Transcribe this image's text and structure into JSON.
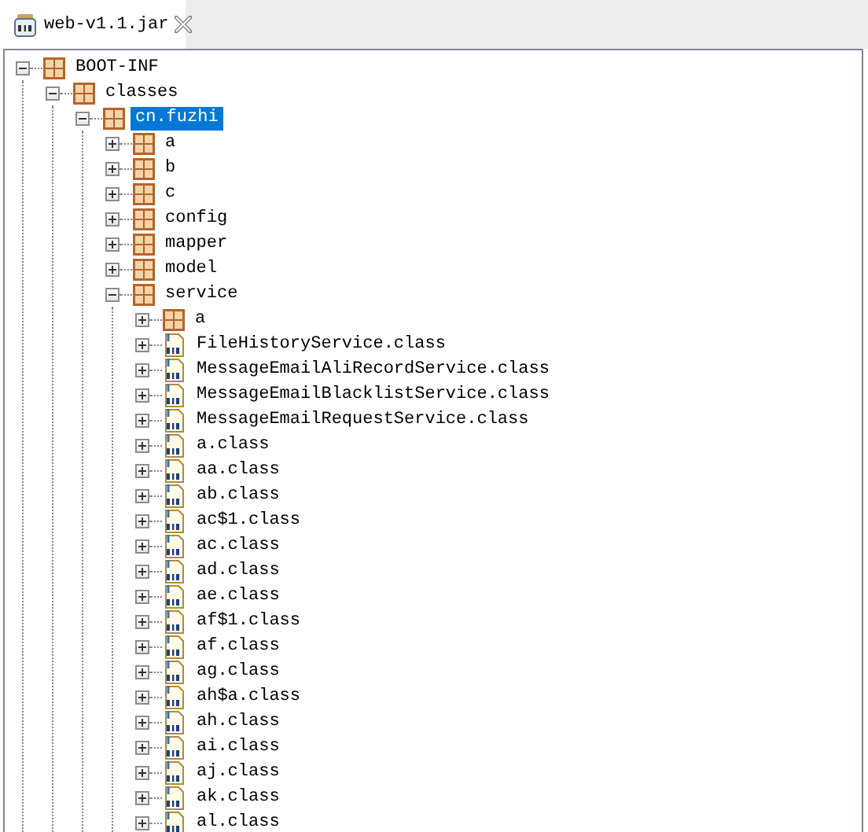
{
  "tabs": [
    {
      "label": "web-v1.1.jar",
      "selected": true
    }
  ],
  "tree": [
    {
      "label": "BOOT-INF",
      "kind": "package",
      "expanded": true,
      "selected": false,
      "children": [
        {
          "label": "classes",
          "kind": "package",
          "expanded": true,
          "selected": false,
          "children": [
            {
              "label": "cn.fuzhi",
              "kind": "package",
              "expanded": true,
              "selected": true,
              "children": [
                {
                  "label": "a",
                  "kind": "package",
                  "expanded": false,
                  "selected": false
                },
                {
                  "label": "b",
                  "kind": "package",
                  "expanded": false,
                  "selected": false
                },
                {
                  "label": "c",
                  "kind": "package",
                  "expanded": false,
                  "selected": false
                },
                {
                  "label": "config",
                  "kind": "package",
                  "expanded": false,
                  "selected": false
                },
                {
                  "label": "mapper",
                  "kind": "package",
                  "expanded": false,
                  "selected": false
                },
                {
                  "label": "model",
                  "kind": "package",
                  "expanded": false,
                  "selected": false
                },
                {
                  "label": "service",
                  "kind": "package",
                  "expanded": true,
                  "selected": false,
                  "children": [
                    {
                      "label": "a",
                      "kind": "package",
                      "expanded": false,
                      "selected": false
                    },
                    {
                      "label": "FileHistoryService.class",
                      "kind": "class",
                      "expanded": false,
                      "selected": false
                    },
                    {
                      "label": "MessageEmailAliRecordService.class",
                      "kind": "class",
                      "expanded": false,
                      "selected": false
                    },
                    {
                      "label": "MessageEmailBlacklistService.class",
                      "kind": "class",
                      "expanded": false,
                      "selected": false
                    },
                    {
                      "label": "MessageEmailRequestService.class",
                      "kind": "class",
                      "expanded": false,
                      "selected": false
                    },
                    {
                      "label": "a.class",
                      "kind": "class",
                      "expanded": false,
                      "selected": false
                    },
                    {
                      "label": "aa.class",
                      "kind": "class",
                      "expanded": false,
                      "selected": false
                    },
                    {
                      "label": "ab.class",
                      "kind": "class",
                      "expanded": false,
                      "selected": false
                    },
                    {
                      "label": "ac$1.class",
                      "kind": "class",
                      "expanded": false,
                      "selected": false
                    },
                    {
                      "label": "ac.class",
                      "kind": "class",
                      "expanded": false,
                      "selected": false
                    },
                    {
                      "label": "ad.class",
                      "kind": "class",
                      "expanded": false,
                      "selected": false
                    },
                    {
                      "label": "ae.class",
                      "kind": "class",
                      "expanded": false,
                      "selected": false
                    },
                    {
                      "label": "af$1.class",
                      "kind": "class",
                      "expanded": false,
                      "selected": false
                    },
                    {
                      "label": "af.class",
                      "kind": "class",
                      "expanded": false,
                      "selected": false
                    },
                    {
                      "label": "ag.class",
                      "kind": "class",
                      "expanded": false,
                      "selected": false
                    },
                    {
                      "label": "ah$a.class",
                      "kind": "class",
                      "expanded": false,
                      "selected": false
                    },
                    {
                      "label": "ah.class",
                      "kind": "class",
                      "expanded": false,
                      "selected": false
                    },
                    {
                      "label": "ai.class",
                      "kind": "class",
                      "expanded": false,
                      "selected": false
                    },
                    {
                      "label": "aj.class",
                      "kind": "class",
                      "expanded": false,
                      "selected": false
                    },
                    {
                      "label": "ak.class",
                      "kind": "class",
                      "expanded": false,
                      "selected": false
                    },
                    {
                      "label": "al.class",
                      "kind": "class",
                      "expanded": false,
                      "selected": false
                    }
                  ]
                }
              ]
            }
          ]
        }
      ]
    }
  ]
}
